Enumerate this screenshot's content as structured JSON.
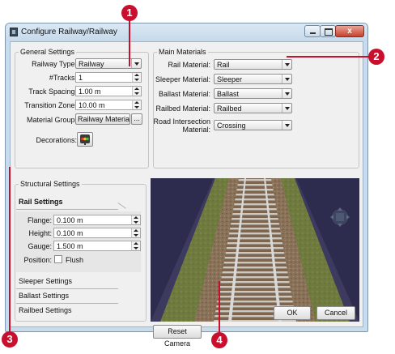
{
  "window": {
    "title": "Configure Railway/Railway",
    "close_glyph": "x"
  },
  "general": {
    "legend": "General Settings",
    "railway_type": {
      "label": "Railway Type:",
      "value": "Railway"
    },
    "tracks": {
      "label": "#Tracks:",
      "value": "1"
    },
    "track_spacing": {
      "label": "Track Spacing:",
      "value": "1.00 m"
    },
    "transition_zone": {
      "label": "Transition Zone:",
      "value": "10.00 m"
    },
    "material_group": {
      "label": "Material Group:",
      "value": "Railway Materials",
      "browse": "..."
    },
    "decorations": {
      "label": "Decorations:",
      "icon": "traffic-light-icon"
    }
  },
  "materials": {
    "legend": "Main Materials",
    "rows": [
      {
        "label": "Rail Material:",
        "value": "Rail"
      },
      {
        "label": "Sleeper Material:",
        "value": "Sleeper"
      },
      {
        "label": "Ballast Material:",
        "value": "Ballast"
      },
      {
        "label": "Railbed Material:",
        "value": "Railbed"
      }
    ],
    "road_intersection": {
      "label_line1": "Road Intersection",
      "label_line2": "Material:",
      "value": "Crossing"
    }
  },
  "structural": {
    "legend": "Structural Settings",
    "rail_settings": {
      "title": "Rail Settings",
      "flange": {
        "label": "Flange:",
        "value": "0.100 m"
      },
      "height": {
        "label": "Height:",
        "value": "0.100 m"
      },
      "gauge": {
        "label": "Gauge:",
        "value": "1.500 m"
      },
      "position": {
        "label": "Position:",
        "checkbox_label": "Flush",
        "checked": false
      }
    },
    "sections": [
      "Sleeper Settings",
      "Ballast Settings",
      "Railbed Settings"
    ]
  },
  "buttons": {
    "reset_camera": "Reset Camera",
    "ok": "OK",
    "cancel": "Cancel"
  },
  "callouts": [
    "1",
    "2",
    "3",
    "4"
  ],
  "colors": {
    "callout": "#c8102e",
    "preview_sky": "#2e2c4e",
    "grass": "#6f7a3f",
    "ballast": "#8a7258",
    "sleeper": "#c9c6bd"
  }
}
